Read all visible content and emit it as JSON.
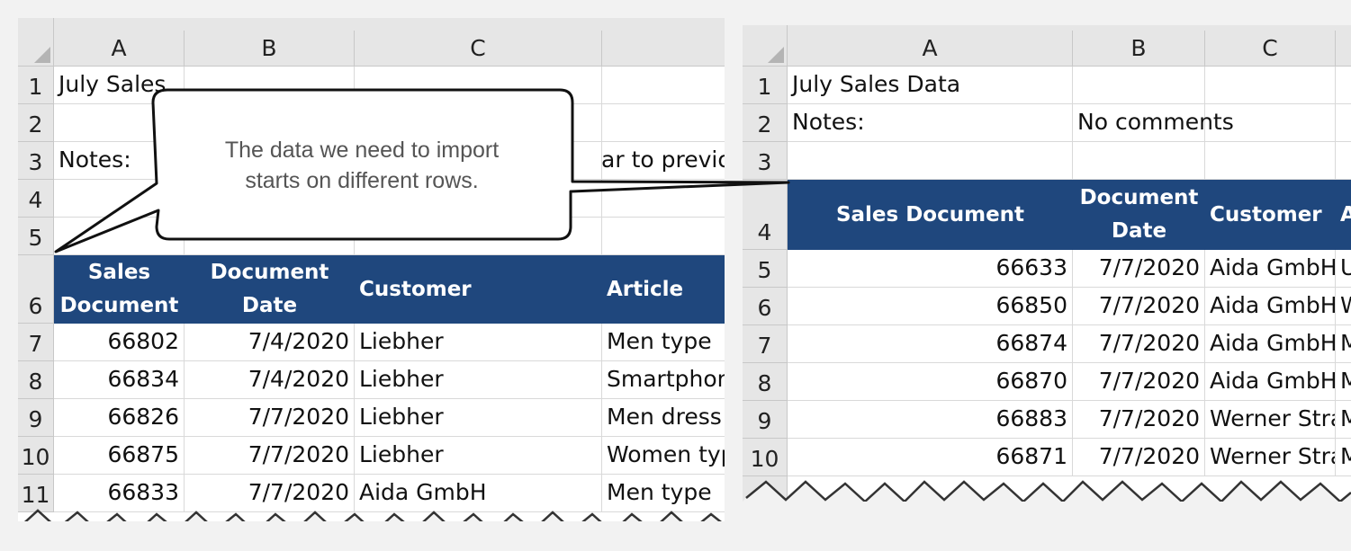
{
  "left_sheet": {
    "columns": [
      "A",
      "B",
      "C"
    ],
    "rows": [
      "1",
      "2",
      "3",
      "4",
      "5",
      "6",
      "7",
      "8",
      "9",
      "10",
      "11"
    ],
    "title_cell": "July Sales",
    "notes_label": "Notes:",
    "notes_value": "Similar to previous",
    "headers": [
      "Sales Document",
      "Document Date",
      "Customer",
      "Article"
    ],
    "data": [
      [
        "66802",
        "7/4/2020",
        "Liebher",
        "Men type"
      ],
      [
        "66834",
        "7/4/2020",
        "Liebher",
        "Smartphone"
      ],
      [
        "66826",
        "7/7/2020",
        "Liebher",
        "Men dress"
      ],
      [
        "66875",
        "7/7/2020",
        "Liebher",
        "Women type"
      ],
      [
        "66833",
        "7/7/2020",
        "Aida GmbH",
        "Men type"
      ]
    ]
  },
  "right_sheet": {
    "columns": [
      "A",
      "B",
      "C"
    ],
    "rows": [
      "1",
      "2",
      "3",
      "4",
      "5",
      "6",
      "7",
      "8",
      "9",
      "10"
    ],
    "title_cell": "July Sales Data",
    "notes_label": "Notes:",
    "notes_value": "No comments",
    "headers": [
      "Sales Document",
      "Document Date",
      "Customer",
      "Article"
    ],
    "data": [
      [
        "66633",
        "7/7/2020",
        "Aida GmbH",
        "U"
      ],
      [
        "66850",
        "7/7/2020",
        "Aida GmbH",
        "W"
      ],
      [
        "66874",
        "7/7/2020",
        "Aida GmbH",
        "M"
      ],
      [
        "66870",
        "7/7/2020",
        "Aida GmbH",
        "M"
      ],
      [
        "66883",
        "7/7/2020",
        "Werner Strauss",
        "M"
      ],
      [
        "66871",
        "7/7/2020",
        "Werner Strauss",
        "M"
      ]
    ]
  },
  "callout": {
    "text": "The data we need to import\nstarts on different rows."
  },
  "colors": {
    "header_fill": "#1f477d",
    "header_text": "#ffffff",
    "background": "#f2f2f2"
  }
}
